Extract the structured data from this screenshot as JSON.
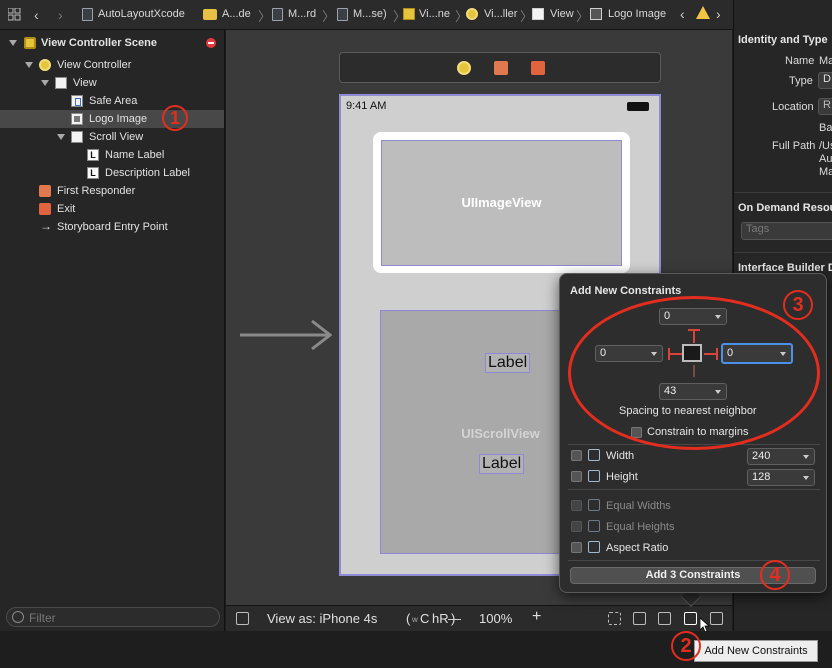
{
  "jumpbar": {
    "items": [
      "AutoLayoutXcode",
      "A...de",
      "M...rd",
      "M...se)",
      "Vi...ne",
      "Vi...ller",
      "View",
      "Logo Image"
    ]
  },
  "outline": {
    "items": [
      {
        "label": "View Controller Scene"
      },
      {
        "label": "View Controller"
      },
      {
        "label": "View"
      },
      {
        "label": "Safe Area"
      },
      {
        "label": "Logo Image"
      },
      {
        "label": "Scroll View"
      },
      {
        "label": "Name Label"
      },
      {
        "label": "Description Label"
      },
      {
        "label": "First Responder"
      },
      {
        "label": "Exit"
      },
      {
        "label": "Storyboard Entry Point"
      }
    ],
    "filter_placeholder": "Filter",
    "callout_1": "1"
  },
  "canvas": {
    "status_time": "9:41 AM",
    "imageview_label": "UIImageView",
    "scrollview_label": "UIScrollView",
    "label_1": "Label",
    "label_2": "Label"
  },
  "bottombar": {
    "view_as": "View as: iPhone 4s",
    "size_class_prefix": "w",
    "size_class_w": "C",
    "size_class_h": "hR",
    "zoom_minus": "—",
    "zoom": "100%",
    "zoom_plus": "+"
  },
  "inspector": {
    "identity_header": "Identity and Type",
    "name_label": "Name",
    "name_value": "Ma",
    "type_label": "Type",
    "type_value": "D",
    "location_label": "Location",
    "location_value": "R",
    "location_sub": "Ba",
    "fullpath_label": "Full Path",
    "fullpath_value_1": "/Us",
    "fullpath_value_2": "Au",
    "fullpath_value_3": "Ma",
    "ondemand_header": "On Demand Resour",
    "tags_placeholder": "Tags",
    "ib_header": "Interface Builder D"
  },
  "popover": {
    "title": "Add New Constraints",
    "top_value": "0",
    "left_value": "0",
    "right_value": "0",
    "bottom_value": "43",
    "spacing_caption": "Spacing to nearest neighbor",
    "constrain_margins": "Constrain to margins",
    "width_label": "Width",
    "width_value": "240",
    "height_label": "Height",
    "height_value": "128",
    "equal_widths": "Equal Widths",
    "equal_heights": "Equal Heights",
    "aspect_ratio": "Aspect Ratio",
    "add_button": "Add 3 Constraints",
    "callout_3": "3",
    "callout_4": "4"
  },
  "tooltip": "Add New Constraints",
  "callout_2": "2",
  "colors": {
    "annotation_red": "#e32d1f",
    "focus_blue": "#4a8fe8",
    "selection": "#8f8bd6"
  }
}
